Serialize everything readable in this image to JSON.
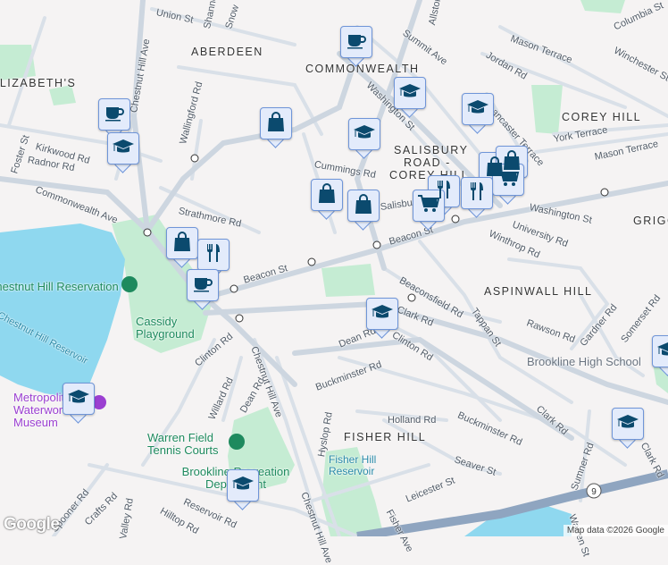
{
  "map": {
    "neighborhoods": [
      "ABERDEEN",
      "COMMONWEALTH",
      "ELIZABETH'S",
      "COREY HILL",
      "SALISBURY",
      "ROAD -",
      "COREY HILL",
      "GRIGGS",
      "ASPINWALL HILL",
      "FISHER HILL"
    ],
    "streets": [
      "Union St",
      "Shannon",
      "Snow",
      "Chestnut Hill Ave",
      "Wallingford Rd",
      "Foster St",
      "Kirkwood Rd",
      "Radnor Rd",
      "Commonwealth Ave",
      "Strathmore Rd",
      "Cummings Rd",
      "Summit Ave",
      "Allston St",
      "Mason Terrace",
      "Jordan Rd",
      "Winchester St",
      "York Terrace",
      "Mason Terrace",
      "Lancaster Terrace",
      "Washington St",
      "Washington St",
      "University Rd",
      "Winthrop Rd",
      "Beacon St",
      "Beacon St",
      "Salisbury Rd",
      "Beaconsfield Rd",
      "Tappan St",
      "Rawson Rd",
      "Gardner Rd",
      "Somerset Rd",
      "Clark Rd",
      "Dean Rd",
      "Clinton Rd",
      "Buckminster Rd",
      "Buckminster Rd",
      "Holland Rd",
      "Seaver St",
      "Leicester St",
      "Clark Rd",
      "Clark Rd",
      "Sumner Rd",
      "Clinton Rd",
      "Willard Rd",
      "Dean Rd",
      "Chestnut Hill Ave",
      "Spooner Rd",
      "Crafts Rd",
      "Valley Rd",
      "Hilltop Rd",
      "Reservoir Rd",
      "Hyslop Rd",
      "Chestnut Hill Ave",
      "Fisher Ave",
      "Warren St",
      "Columbia St"
    ],
    "places": {
      "reservation": "Chestnut Hill Reservation",
      "reservoir": "Chestnut Hill Reservoir",
      "playground": "Cassidy Playground",
      "tennis": "Warren Field Tennis Courts",
      "recreation": "Brookline Recreation Department",
      "fisher_reservoir": "Fisher Hill Reservoir",
      "museum": "Metropolitan Waterworks Museum",
      "high_school": "Brookline High School"
    },
    "route_shield": "9",
    "markers": [
      "coffee",
      "coffee",
      "graduation-cap",
      "shopping-bag",
      "graduation-cap",
      "graduation-cap",
      "graduation-cap",
      "shopping-bag",
      "shopping-bag",
      "shopping-bag",
      "restaurant",
      "coffee",
      "shopping-bag",
      "shopping-bag",
      "shopping-cart",
      "restaurant",
      "restaurant",
      "shopping-cart",
      "graduation-cap",
      "graduation-cap",
      "graduation-cap",
      "graduation-cap",
      "graduation-cap"
    ],
    "colors": {
      "marker_fill": "#e3ebfb",
      "marker_icon": "#0b4a6e",
      "water": "#8fd8ef",
      "park": "#c5ecd3",
      "road": "#d5dde6",
      "highway": "#8fa5c0"
    }
  },
  "footer": {
    "logo": "Google",
    "attribution": "Map data ©2026 Google"
  }
}
